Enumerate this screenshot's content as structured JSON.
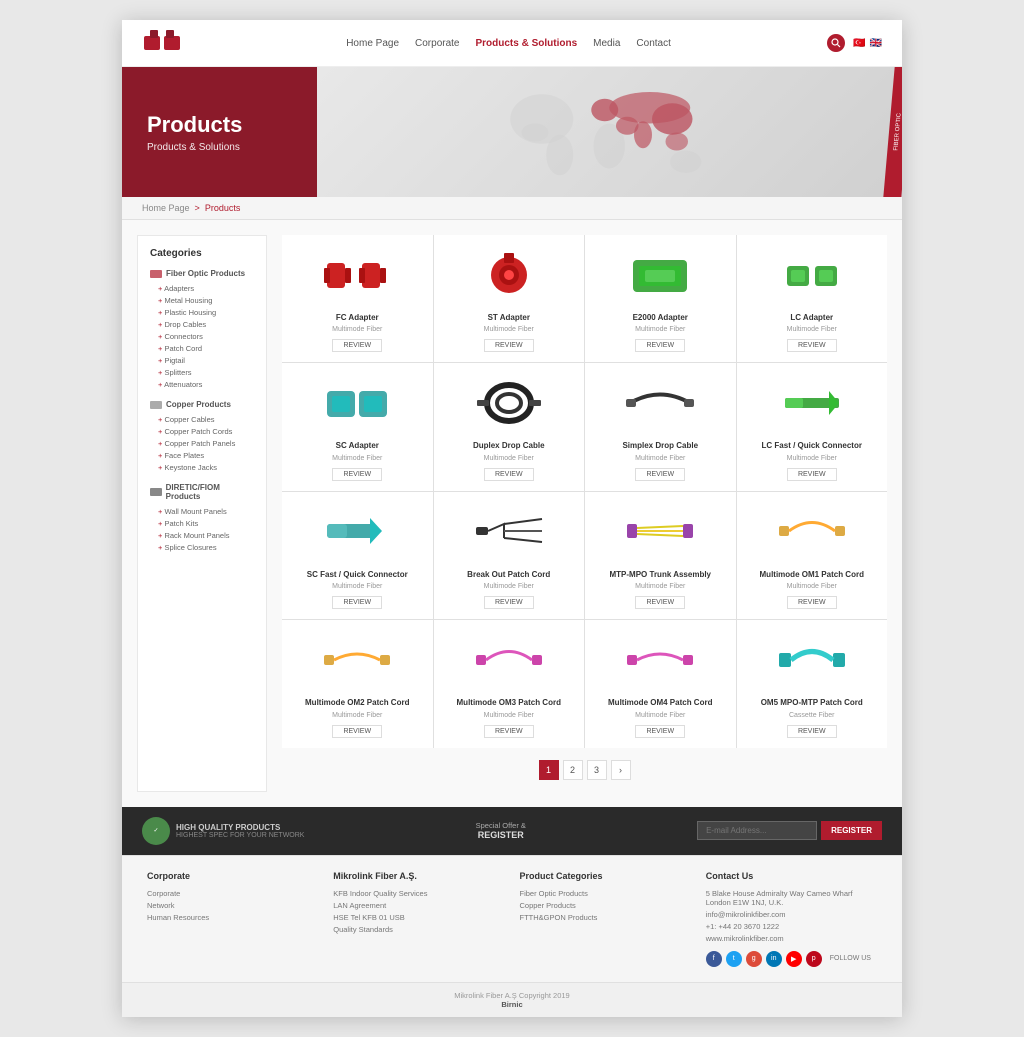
{
  "header": {
    "logo_alt": "Mikrotik Fiber",
    "nav": [
      {
        "label": "Home Page",
        "active": false
      },
      {
        "label": "Corporate",
        "active": false
      },
      {
        "label": "Products & Solutions",
        "active": true
      },
      {
        "label": "Media",
        "active": false
      },
      {
        "label": "Contact",
        "active": false
      }
    ]
  },
  "hero": {
    "title": "Products",
    "subtitle": "Products & Solutions",
    "stripe_text": "FIBER OPTIC"
  },
  "breadcrumb": {
    "home": "Home Page",
    "separator": ">",
    "current": "Products"
  },
  "sidebar": {
    "title": "Categories",
    "groups": [
      {
        "title": "Fiber Optic Products",
        "items": [
          "Adapters",
          "Metal Housing",
          "Plastic Housing",
          "Drop Cables",
          "Connectors",
          "Patch Cord",
          "Pigtail",
          "Splitters",
          "Attenuators"
        ]
      },
      {
        "title": "Copper Products",
        "items": [
          "Copper Cables",
          "Copper Patch Cords",
          "Copper Patch Panels",
          "Face Plates",
          "Keystone Jacks"
        ]
      },
      {
        "title": "DIRETIC/FIOM Products",
        "items": [
          "Wall Mount Panels",
          "Patch Kits",
          "Rack Mount Panels",
          "Splice Closures"
        ]
      }
    ]
  },
  "products": [
    {
      "name": "FC Adapter",
      "category": "Multimode Fiber",
      "color1": "#cc2222",
      "color2": "#dd4444"
    },
    {
      "name": "ST Adapter",
      "category": "Multimode Fiber",
      "color1": "#cc2222",
      "color2": "#ff4444"
    },
    {
      "name": "E2000 Adapter",
      "category": "Multimode Fiber",
      "color1": "#44aa44",
      "color2": "#55cc55"
    },
    {
      "name": "LC Adapter",
      "category": "Multimode Fiber",
      "color1": "#44aa44",
      "color2": "#33bb33"
    },
    {
      "name": "SC Adapter",
      "category": "Multimode Fiber",
      "color1": "#44aaaa",
      "color2": "#22bbbb"
    },
    {
      "name": "Duplex Drop Cable",
      "category": "Multimode Fiber",
      "color1": "#222222",
      "color2": "#444444"
    },
    {
      "name": "Simplex Drop Cable",
      "category": "Multimode Fiber",
      "color1": "#333333",
      "color2": "#555555"
    },
    {
      "name": "LC Fast / Quick Connector",
      "category": "Multimode Fiber",
      "color1": "#44aa44",
      "color2": "#33bb33"
    },
    {
      "name": "SC Fast / Quick Connector",
      "category": "Multimode Fiber",
      "color1": "#44aaaa",
      "color2": "#22bbbb"
    },
    {
      "name": "Break Out Patch Cord",
      "category": "Multimode Fiber",
      "color1": "#222222",
      "color2": "#444444"
    },
    {
      "name": "MTP-MPO Trunk Assembly",
      "category": "Multimode Fiber",
      "color1": "#ddcc22",
      "color2": "#eecc33"
    },
    {
      "name": "Multimode OM1 Patch Cord",
      "category": "Multimode Fiber",
      "color1": "#ddaa44",
      "color2": "#ffaa33"
    },
    {
      "name": "Multimode OM2 Patch Cord",
      "category": "Multimode Fiber",
      "color1": "#ddaa44",
      "color2": "#ffaa33"
    },
    {
      "name": "Multimode OM3 Patch Cord",
      "category": "Multimode Fiber",
      "color1": "#cc44aa",
      "color2": "#dd55bb"
    },
    {
      "name": "Multimode OM4 Patch Cord",
      "category": "Multimode Fiber",
      "color1": "#cc44aa",
      "color2": "#dd55bb"
    },
    {
      "name": "OM5 MPO-MTP Patch Cord",
      "category": "Cassette Fiber",
      "color1": "#22aaaa",
      "color2": "#33cccc"
    }
  ],
  "review_label": "REVIEW",
  "pagination": {
    "pages": [
      "1",
      "2",
      "3"
    ],
    "active": "1",
    "next": "›"
  },
  "footer_dark": {
    "quality_label": "HIGH QUALITY PRODUCTS",
    "quality_sub": "HIGHEST SPEC FOR YOUR NETWORK",
    "special_label": "Special Offer &",
    "register_label": "REGISTER",
    "newsletter_placeholder": "E-mail Address..."
  },
  "footer": {
    "cols": [
      {
        "title": "Corporate",
        "links": [
          "Corporate",
          "Network",
          "Human Resources"
        ]
      },
      {
        "title": "Mikrolink Fiber A.Ş.",
        "links": [
          "KFB Indoor Quality Services",
          "LAN Agreement",
          "HSE Tel KFB 01 USB",
          "Quality Standards"
        ]
      },
      {
        "title": "Product Categories",
        "links": [
          "Fiber Optic Products",
          "Copper Products",
          "FTTH&GPON Products"
        ]
      },
      {
        "title": "Contact Us",
        "links": [
          "5 Blake House Admiralty Way Cameo Wharf London E1W 1NJ, U.K.",
          "info@mikrolinkfiber.com",
          "+1: +44 20 3670 1222",
          "www.mikrolinkfiber.com"
        ]
      }
    ],
    "social": [
      {
        "name": "facebook",
        "color": "#3b5998"
      },
      {
        "name": "twitter",
        "color": "#1da1f2"
      },
      {
        "name": "google-plus",
        "color": "#dd4b39"
      },
      {
        "name": "linkedin",
        "color": "#0077b5"
      },
      {
        "name": "youtube",
        "color": "#ff0000"
      },
      {
        "name": "pinterest",
        "color": "#bd081c"
      }
    ],
    "follow_label": "FOLLOW US",
    "copyright": "Mikrolink Fiber A.Ş Copyright 2019",
    "powered_by": "Birnic"
  }
}
